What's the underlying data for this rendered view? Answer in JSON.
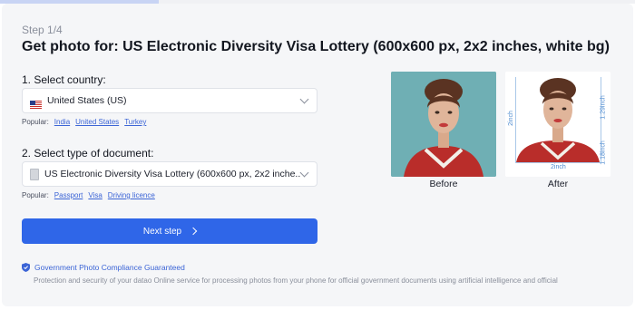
{
  "progress": {
    "percent": 25
  },
  "step": "Step 1/4",
  "title": "Get photo for: US Electronic Diversity Visa Lottery (600x600 px, 2x2 inches, white bg)",
  "country": {
    "label": "1. Select country:",
    "value": "United States (US)",
    "icon": "us-flag-icon",
    "popular_label": "Popular:",
    "popular": [
      "India",
      "United States",
      "Turkey"
    ]
  },
  "document": {
    "label": "2. Select type of document:",
    "value": "US Electronic Diversity Visa Lottery (600x600 px, 2x2 inche...",
    "icon": "document-icon",
    "popular_label": "Popular:",
    "popular": [
      "Passport",
      "Visa",
      "Driving licence"
    ]
  },
  "next_button": "Next step",
  "guarantee": "Government Photo Compliance Guaranteed",
  "protection_text": "Protection and security of your datao Online service for processing photos from your phone for official government documents using artificial intelligence and official",
  "preview": {
    "before_label": "Before",
    "after_label": "After",
    "dim_height": "2inch",
    "dim_width": "2inch",
    "dim_head": "1.29inch",
    "dim_eyes": "1.18inch"
  },
  "colors": {
    "accent": "#2f66e8",
    "before_bg": "#6fafb4",
    "card_bg": "#f5f6f8"
  }
}
